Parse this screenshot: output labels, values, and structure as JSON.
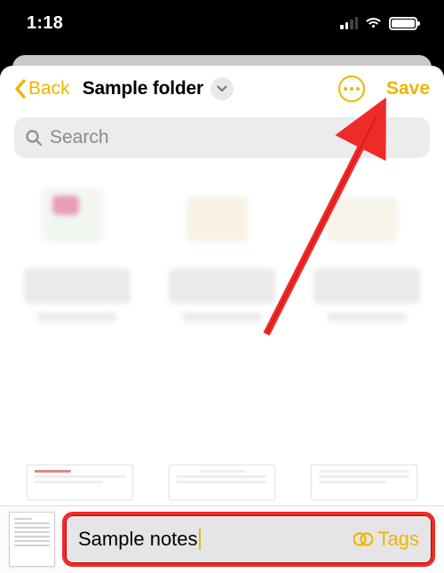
{
  "status": {
    "time": "1:18"
  },
  "nav": {
    "back_label": "Back",
    "title": "Sample folder",
    "save_label": "Save"
  },
  "search": {
    "placeholder": "Search"
  },
  "editor": {
    "note_title": "Sample notes",
    "tags_label": "Tags"
  }
}
